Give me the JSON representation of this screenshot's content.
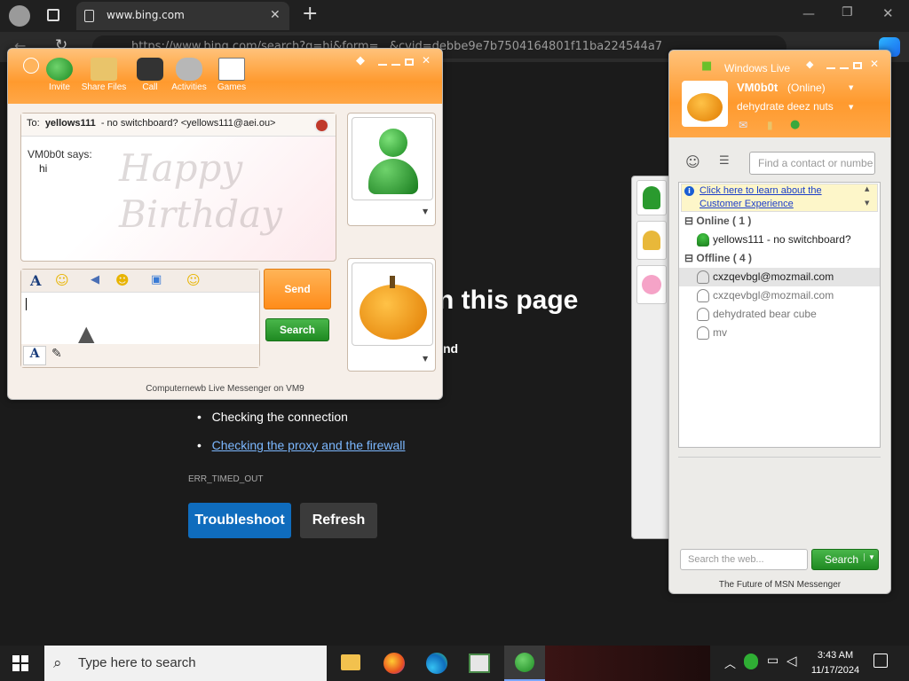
{
  "browser": {
    "tab_title": "www.bing.com",
    "url": "https://www.bing.com/search?q=hi&form=...&cvid=debbe9e7b7504164801f11ba224544a7",
    "error": {
      "heading": "n this page",
      "partial_text": "nd",
      "bullets": [
        "Checking the connection",
        "Checking the proxy and the firewall"
      ],
      "code": "ERR_TIMED_OUT",
      "troubleshoot_label": "Troubleshoot",
      "refresh_label": "Refresh"
    }
  },
  "chat": {
    "toolbar": [
      "Invite",
      "Share Files",
      "Call",
      "Activities",
      "Games"
    ],
    "to_prefix": "To:",
    "to_name": "yellows111",
    "to_detail": "- no switchboard? <yellows111@aei.ou>",
    "message_sender": "VM0b0t says:",
    "message_text": "hi",
    "background_text": "Happy Birthday",
    "send_label": "Send",
    "search_label": "Search",
    "status_bar": "Computernewb Live Messenger on VM9"
  },
  "contacts": {
    "brand": "Windows Live",
    "username": "VM0b0t",
    "status": "(Online)",
    "personal_message": "dehydrate deez nuts",
    "search_placeholder": "Find a contact or numbe",
    "info_link": "Click here to learn about the Customer Experience",
    "online_group": "Online ( 1 )",
    "online_contacts": [
      "yellows111 - no switchboard?"
    ],
    "offline_group": "Offline ( 4 )",
    "offline_contacts": [
      "cxzqevbgl@mozmail.com",
      "cxzqevbgl@mozmail.com",
      "dehydrated bear cube",
      "mv"
    ],
    "web_search_placeholder": "Search the web...",
    "web_search_button": "Search",
    "footer": "The Future of MSN Messenger"
  },
  "taskbar": {
    "search_placeholder": "Type here to search",
    "time": "3:43 AM",
    "date": "11/17/2024"
  },
  "colors": {
    "accent_orange": "#ff9a2e",
    "msn_green": "#1f8a22",
    "edge_blue": "#0f6cbd"
  }
}
